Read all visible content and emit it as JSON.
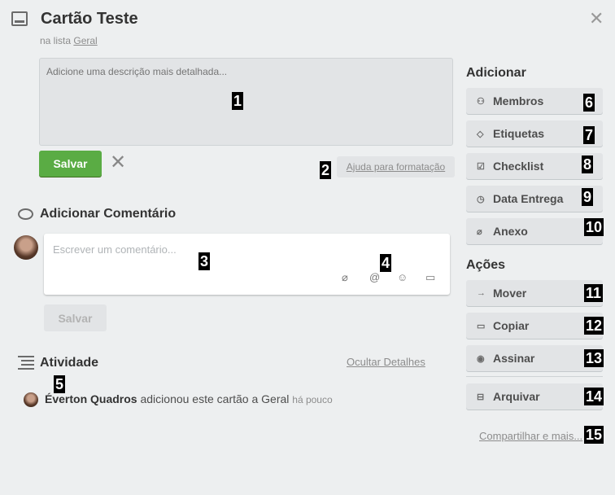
{
  "card": {
    "title": "Cartão Teste",
    "list_prefix": "na lista",
    "list_name": "Geral"
  },
  "description": {
    "placeholder": "Adicione uma descrição mais detalhada...",
    "save_label": "Salvar",
    "cancel_glyph": "✕",
    "help_label": "Ajuda para formatação"
  },
  "comment": {
    "heading": "Adicionar Comentário",
    "placeholder": "Escrever um comentário...",
    "save_label": "Salvar",
    "tools": [
      "attachment-icon",
      "mention-icon",
      "emoji-icon",
      "card-icon"
    ]
  },
  "activity": {
    "heading": "Atividade",
    "hide_details": "Ocultar Detalhes",
    "entries": [
      {
        "user": "Éverton Quadros",
        "action": "adicionou este cartão a Geral",
        "time": "há pouco"
      }
    ]
  },
  "sidebar": {
    "add_heading": "Adicionar",
    "add_items": [
      {
        "label": "Membros",
        "icon": "user-icon"
      },
      {
        "label": "Etiquetas",
        "icon": "tag-icon"
      },
      {
        "label": "Checklist",
        "icon": "checkbox-icon"
      },
      {
        "label": "Data Entrega",
        "icon": "clock-icon"
      },
      {
        "label": "Anexo",
        "icon": "paperclip-icon"
      }
    ],
    "actions_heading": "Ações",
    "action_items": [
      {
        "label": "Mover",
        "icon": "arrow-right-icon"
      },
      {
        "label": "Copiar",
        "icon": "card-icon"
      },
      {
        "label": "Assinar",
        "icon": "eye-icon"
      },
      {
        "label": "Arquivar",
        "icon": "archive-icon"
      }
    ],
    "share_label": "Compartilhar e mais..."
  },
  "badges": [
    "1",
    "2",
    "3",
    "4",
    "5",
    "6",
    "7",
    "8",
    "9",
    "10",
    "11",
    "12",
    "13",
    "14",
    "15"
  ],
  "colors": {
    "save_green": "#5aac44",
    "background": "#edeff0",
    "button_gray": "#e2e4e6"
  }
}
